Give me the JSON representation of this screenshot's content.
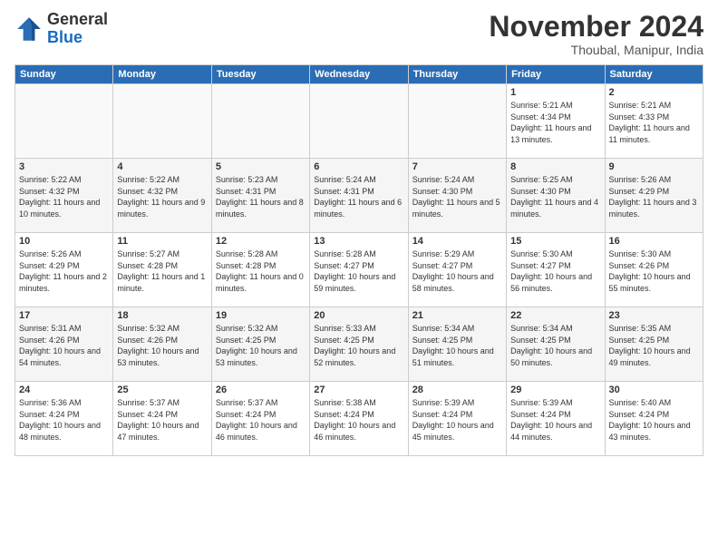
{
  "header": {
    "logo_general": "General",
    "logo_blue": "Blue",
    "month_title": "November 2024",
    "location": "Thoubal, Manipur, India"
  },
  "days_of_week": [
    "Sunday",
    "Monday",
    "Tuesday",
    "Wednesday",
    "Thursday",
    "Friday",
    "Saturday"
  ],
  "weeks": [
    [
      {
        "day": "",
        "info": ""
      },
      {
        "day": "",
        "info": ""
      },
      {
        "day": "",
        "info": ""
      },
      {
        "day": "",
        "info": ""
      },
      {
        "day": "",
        "info": ""
      },
      {
        "day": "1",
        "info": "Sunrise: 5:21 AM\nSunset: 4:34 PM\nDaylight: 11 hours and 13 minutes."
      },
      {
        "day": "2",
        "info": "Sunrise: 5:21 AM\nSunset: 4:33 PM\nDaylight: 11 hours and 11 minutes."
      }
    ],
    [
      {
        "day": "3",
        "info": "Sunrise: 5:22 AM\nSunset: 4:32 PM\nDaylight: 11 hours and 10 minutes."
      },
      {
        "day": "4",
        "info": "Sunrise: 5:22 AM\nSunset: 4:32 PM\nDaylight: 11 hours and 9 minutes."
      },
      {
        "day": "5",
        "info": "Sunrise: 5:23 AM\nSunset: 4:31 PM\nDaylight: 11 hours and 8 minutes."
      },
      {
        "day": "6",
        "info": "Sunrise: 5:24 AM\nSunset: 4:31 PM\nDaylight: 11 hours and 6 minutes."
      },
      {
        "day": "7",
        "info": "Sunrise: 5:24 AM\nSunset: 4:30 PM\nDaylight: 11 hours and 5 minutes."
      },
      {
        "day": "8",
        "info": "Sunrise: 5:25 AM\nSunset: 4:30 PM\nDaylight: 11 hours and 4 minutes."
      },
      {
        "day": "9",
        "info": "Sunrise: 5:26 AM\nSunset: 4:29 PM\nDaylight: 11 hours and 3 minutes."
      }
    ],
    [
      {
        "day": "10",
        "info": "Sunrise: 5:26 AM\nSunset: 4:29 PM\nDaylight: 11 hours and 2 minutes."
      },
      {
        "day": "11",
        "info": "Sunrise: 5:27 AM\nSunset: 4:28 PM\nDaylight: 11 hours and 1 minute."
      },
      {
        "day": "12",
        "info": "Sunrise: 5:28 AM\nSunset: 4:28 PM\nDaylight: 11 hours and 0 minutes."
      },
      {
        "day": "13",
        "info": "Sunrise: 5:28 AM\nSunset: 4:27 PM\nDaylight: 10 hours and 59 minutes."
      },
      {
        "day": "14",
        "info": "Sunrise: 5:29 AM\nSunset: 4:27 PM\nDaylight: 10 hours and 58 minutes."
      },
      {
        "day": "15",
        "info": "Sunrise: 5:30 AM\nSunset: 4:27 PM\nDaylight: 10 hours and 56 minutes."
      },
      {
        "day": "16",
        "info": "Sunrise: 5:30 AM\nSunset: 4:26 PM\nDaylight: 10 hours and 55 minutes."
      }
    ],
    [
      {
        "day": "17",
        "info": "Sunrise: 5:31 AM\nSunset: 4:26 PM\nDaylight: 10 hours and 54 minutes."
      },
      {
        "day": "18",
        "info": "Sunrise: 5:32 AM\nSunset: 4:26 PM\nDaylight: 10 hours and 53 minutes."
      },
      {
        "day": "19",
        "info": "Sunrise: 5:32 AM\nSunset: 4:25 PM\nDaylight: 10 hours and 53 minutes."
      },
      {
        "day": "20",
        "info": "Sunrise: 5:33 AM\nSunset: 4:25 PM\nDaylight: 10 hours and 52 minutes."
      },
      {
        "day": "21",
        "info": "Sunrise: 5:34 AM\nSunset: 4:25 PM\nDaylight: 10 hours and 51 minutes."
      },
      {
        "day": "22",
        "info": "Sunrise: 5:34 AM\nSunset: 4:25 PM\nDaylight: 10 hours and 50 minutes."
      },
      {
        "day": "23",
        "info": "Sunrise: 5:35 AM\nSunset: 4:25 PM\nDaylight: 10 hours and 49 minutes."
      }
    ],
    [
      {
        "day": "24",
        "info": "Sunrise: 5:36 AM\nSunset: 4:24 PM\nDaylight: 10 hours and 48 minutes."
      },
      {
        "day": "25",
        "info": "Sunrise: 5:37 AM\nSunset: 4:24 PM\nDaylight: 10 hours and 47 minutes."
      },
      {
        "day": "26",
        "info": "Sunrise: 5:37 AM\nSunset: 4:24 PM\nDaylight: 10 hours and 46 minutes."
      },
      {
        "day": "27",
        "info": "Sunrise: 5:38 AM\nSunset: 4:24 PM\nDaylight: 10 hours and 46 minutes."
      },
      {
        "day": "28",
        "info": "Sunrise: 5:39 AM\nSunset: 4:24 PM\nDaylight: 10 hours and 45 minutes."
      },
      {
        "day": "29",
        "info": "Sunrise: 5:39 AM\nSunset: 4:24 PM\nDaylight: 10 hours and 44 minutes."
      },
      {
        "day": "30",
        "info": "Sunrise: 5:40 AM\nSunset: 4:24 PM\nDaylight: 10 hours and 43 minutes."
      }
    ]
  ]
}
